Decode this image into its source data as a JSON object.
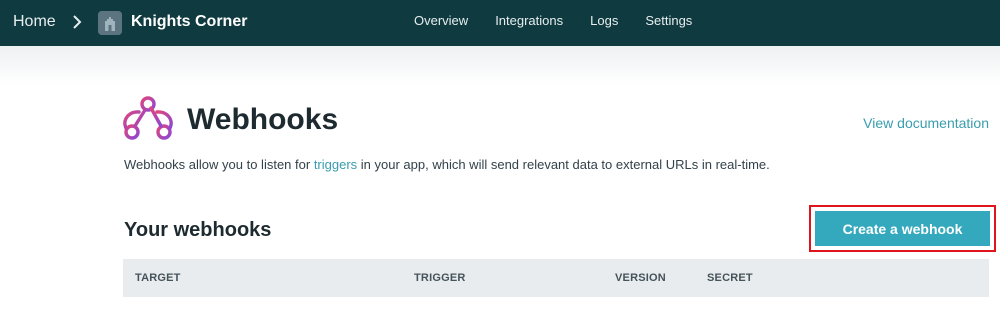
{
  "topbar": {
    "home_label": "Home",
    "app_name": "Knights Corner",
    "nav": [
      "Overview",
      "Integrations",
      "Logs",
      "Settings"
    ],
    "background": "#0f3a3f"
  },
  "header": {
    "title": "Webhooks",
    "doc_link": "View documentation",
    "icon": "webhook-icon",
    "icon_gradient": [
      "#e0457b",
      "#8b47d6"
    ]
  },
  "description": {
    "before": "Webhooks allow you to listen for ",
    "link": "triggers",
    "after": " in your app, which will send relevant data to external URLs in real-time."
  },
  "webhooks": {
    "section_title": "Your webhooks",
    "create_label": "Create a webhook",
    "accent": "#34a9bd",
    "highlight": "#e0141c",
    "columns": [
      "TARGET",
      "TRIGGER",
      "VERSION",
      "SECRET"
    ]
  }
}
